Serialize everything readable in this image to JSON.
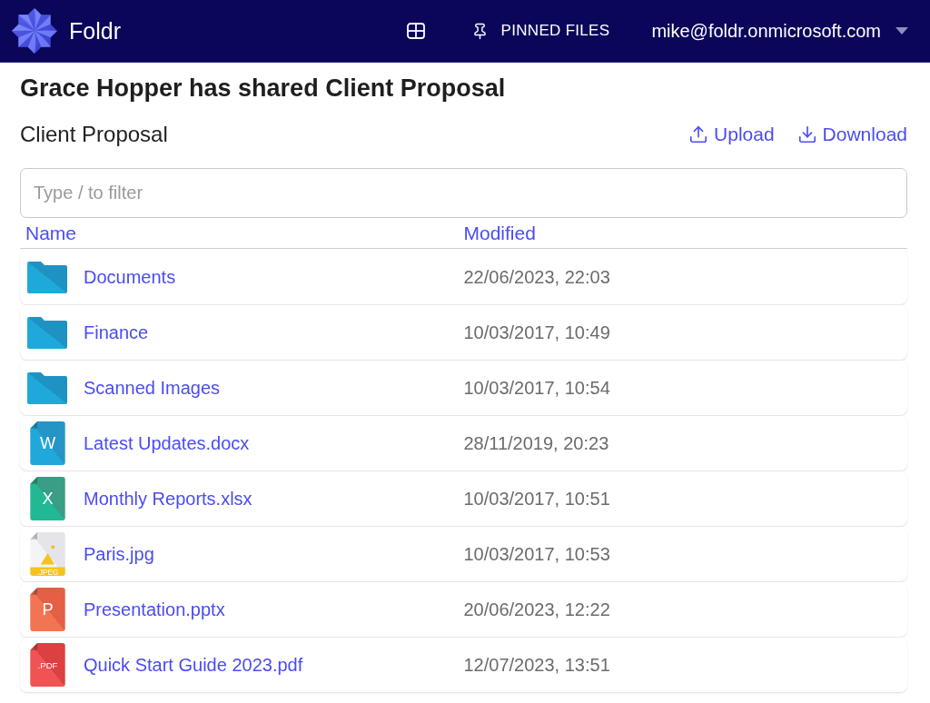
{
  "app": {
    "name": "Foldr"
  },
  "nav": {
    "pinned": {
      "label": "PINNED FILES"
    },
    "account": {
      "email": "mike@foldr.onmicrosoft.com"
    }
  },
  "page": {
    "title": "Grace Hopper has shared Client Proposal",
    "folder_name": "Client Proposal",
    "actions": [
      {
        "kind": "upload",
        "label": "Upload"
      },
      {
        "kind": "download",
        "label": "Download"
      }
    ]
  },
  "filter": {
    "placeholder": "Type / to filter"
  },
  "table": {
    "columns": [
      "Name",
      "Modified"
    ],
    "rows": [
      {
        "kind": "folder",
        "name": "Documents",
        "modified": "22/06/2023, 22:03"
      },
      {
        "kind": "folder",
        "name": "Finance",
        "modified": "10/03/2017, 10:49"
      },
      {
        "kind": "folder",
        "name": "Scanned Images",
        "modified": "10/03/2017, 10:54"
      },
      {
        "kind": "word",
        "badge": "W",
        "name": "Latest Updates.docx",
        "modified": "28/11/2019, 20:23"
      },
      {
        "kind": "excel",
        "badge": "X",
        "name": "Monthly Reports.xlsx",
        "modified": "10/03/2017, 10:51"
      },
      {
        "kind": "image",
        "badge": ".JPEG",
        "name": "Paris.jpg",
        "modified": "10/03/2017, 10:53"
      },
      {
        "kind": "powerpoint",
        "badge": "P",
        "name": "Presentation.pptx",
        "modified": "20/06/2023, 12:22"
      },
      {
        "kind": "pdf",
        "badge": ".PDF",
        "name": "Quick Start Guide 2023.pdf",
        "modified": "12/07/2023, 13:51"
      }
    ]
  }
}
